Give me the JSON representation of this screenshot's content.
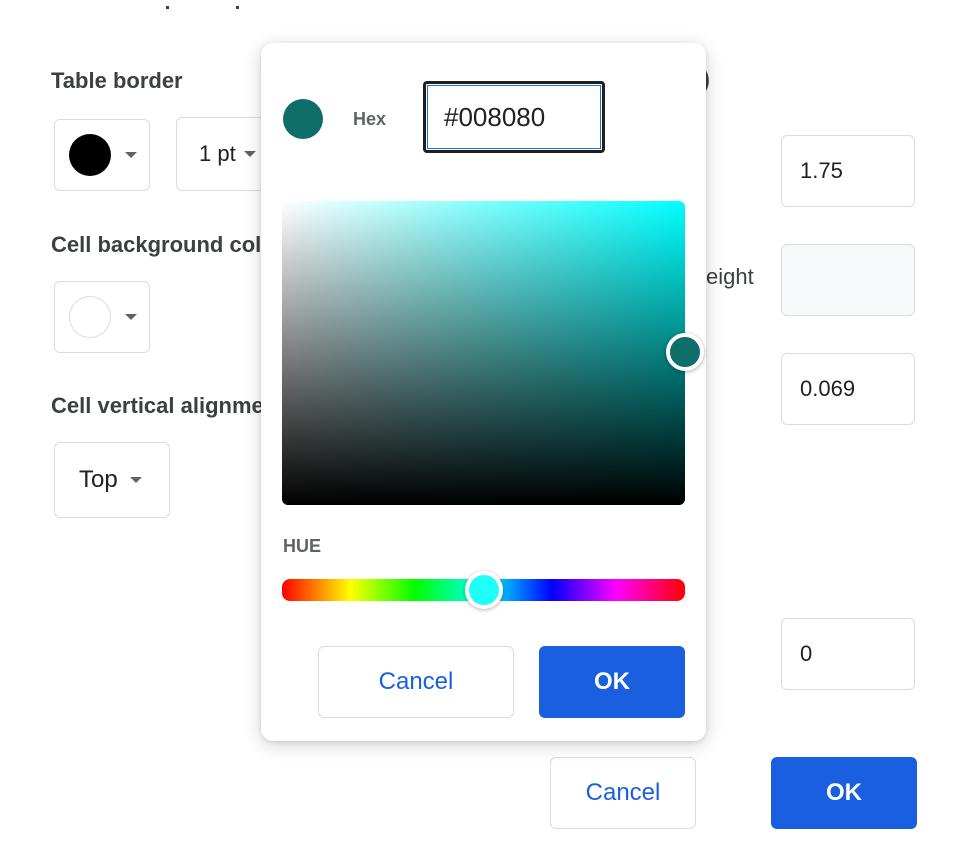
{
  "dialog": {
    "table_border": {
      "label": "Table border",
      "color_value": "#000000",
      "width_value": "1 pt"
    },
    "cell_background": {
      "label": "Cell background color",
      "color_value": "#ffffff"
    },
    "cell_vertical_alignment": {
      "label": "Cell vertical alignment",
      "value": "Top"
    },
    "right_column": {
      "partial_header_text": ")",
      "fields": [
        {
          "name": "field-1",
          "value": "1.75"
        },
        {
          "name": "row-height",
          "label_partial": "eight",
          "value": "",
          "disabled": true
        },
        {
          "name": "cell-padding",
          "value": "0.069"
        },
        {
          "name": "field-4",
          "value": "0"
        }
      ]
    },
    "cancel_label": "Cancel",
    "ok_label": "OK"
  },
  "color_picker": {
    "hex_label": "Hex",
    "hex_value": "#008080",
    "selected_color": "#0f6e6a",
    "hue_label": "HUE",
    "hue_color": "#1ffff8",
    "hue_degrees": 180,
    "hue_fraction": 0.5,
    "saturation": 1.0,
    "brightness": 0.5,
    "cancel_label": "Cancel",
    "ok_label": "OK"
  },
  "colors": {
    "accent": "#1a5fe0"
  }
}
